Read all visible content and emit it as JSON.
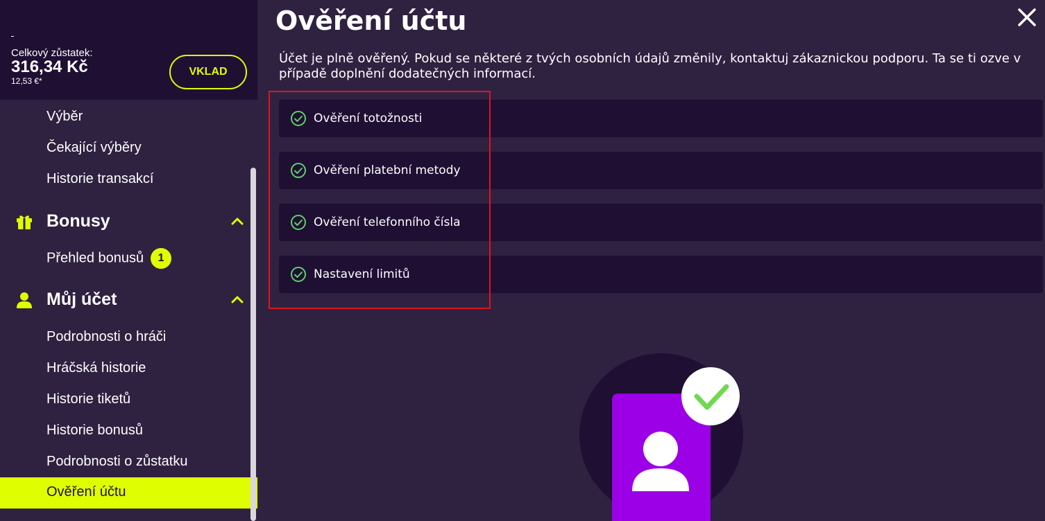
{
  "sidebar": {
    "balance": {
      "label": "Celkový zůstatek:",
      "amount": "316,34 Kč",
      "eur": "12,53 €*",
      "deposit_label": "VKLAD"
    },
    "top_items": [
      {
        "label": "Výběr"
      },
      {
        "label": "Čekající výběry"
      },
      {
        "label": "Historie transakcí"
      }
    ],
    "bonuses": {
      "title": "Bonusy",
      "icon": "gift-icon",
      "items": [
        {
          "label": "Přehled bonusů",
          "badge": "1"
        }
      ]
    },
    "account": {
      "title": "Můj účet",
      "icon": "user-icon",
      "items": [
        {
          "label": "Podrobnosti o hráči"
        },
        {
          "label": "Hráčská historie"
        },
        {
          "label": "Historie tiketů"
        },
        {
          "label": "Historie bonusů"
        },
        {
          "label": "Podrobnosti o zůstatku"
        },
        {
          "label": "Ověření účtu",
          "active": true
        }
      ]
    }
  },
  "main": {
    "title": "Ověření účtu",
    "description": "Účet je plně ověřený. Pokud se některé z tvých osobních údajů změnily, kontaktuj zákaznickou podporu. Ta se ti ozve v případě doplnění dodatečných informací.",
    "verifications": [
      {
        "label": "Ověření totožnosti",
        "status": "verified"
      },
      {
        "label": "Ověření platební metody",
        "status": "verified"
      },
      {
        "label": "Ověření telefonního čísla",
        "status": "verified"
      },
      {
        "label": "Nastavení limitů",
        "status": "verified"
      }
    ]
  },
  "colors": {
    "accent": "#dfff00",
    "panel_bg": "#1f0f33",
    "page_bg": "#2f2140",
    "check_green": "#5fd068",
    "highlight_red": "#e0141e",
    "illustration_purple": "#9b00e6"
  }
}
